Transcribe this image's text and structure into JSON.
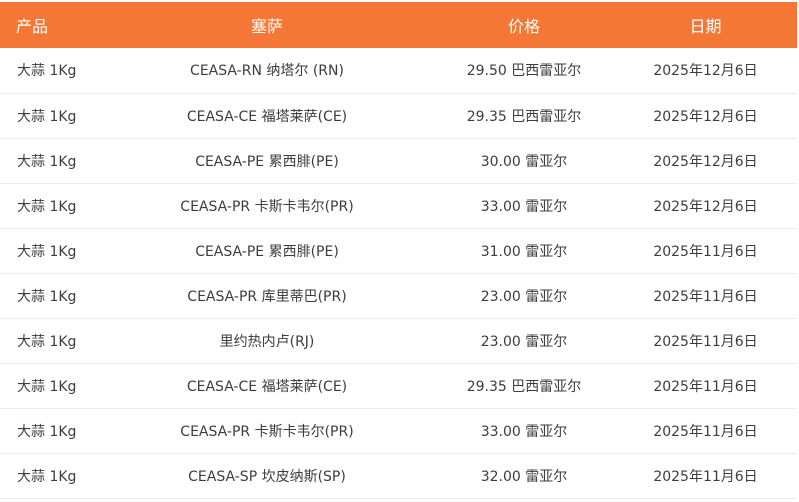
{
  "colors": {
    "header_bg": "#f47735",
    "header_text": "#ffffff",
    "row_text": "#3d3d3d",
    "row_border": "#ececec"
  },
  "table": {
    "headers": [
      "产品",
      "塞萨",
      "价格",
      "日期"
    ],
    "rows": [
      [
        "大蒜 1Kg",
        "CEASA-RN 纳塔尔 (RN)",
        "29.50 巴西雷亚尔",
        "2025年12月6日"
      ],
      [
        "大蒜 1Kg",
        "CEASA-CE 福塔莱萨(CE)",
        "29.35 巴西雷亚尔",
        "2025年12月6日"
      ],
      [
        "大蒜 1Kg",
        "CEASA-PE 累西腓(PE)",
        "30.00 雷亚尔",
        "2025年12月6日"
      ],
      [
        "大蒜 1Kg",
        "CEASA-PR 卡斯卡韦尔(PR)",
        "33.00 雷亚尔",
        "2025年12月6日"
      ],
      [
        "大蒜 1Kg",
        "CEASA-PE 累西腓(PE)",
        "31.00 雷亚尔",
        "2025年11月6日"
      ],
      [
        "大蒜 1Kg",
        "CEASA-PR 库里蒂巴(PR)",
        "23.00 雷亚尔",
        "2025年11月6日"
      ],
      [
        "大蒜 1Kg",
        "里约热内卢(RJ)",
        "23.00 雷亚尔",
        "2025年11月6日"
      ],
      [
        "大蒜 1Kg",
        "CEASA-CE 福塔莱萨(CE)",
        "29.35 巴西雷亚尔",
        "2025年11月6日"
      ],
      [
        "大蒜 1Kg",
        "CEASA-PR 卡斯卡韦尔(PR)",
        "33.00 雷亚尔",
        "2025年11月6日"
      ],
      [
        "大蒜 1Kg",
        "CEASA-SP 坎皮纳斯(SP)",
        "32.00 雷亚尔",
        "2025年11月6日"
      ]
    ]
  }
}
